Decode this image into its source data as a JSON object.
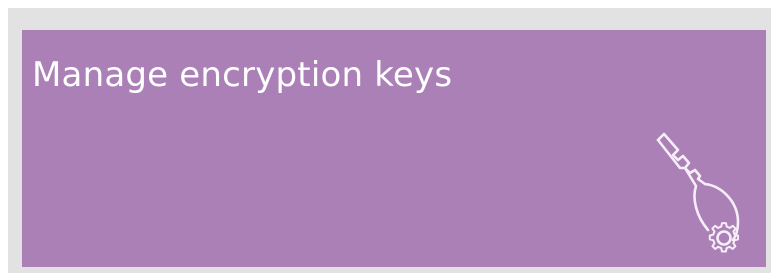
{
  "tile": {
    "title": "Manage encryption keys",
    "icon": "key-gear-icon",
    "background_color": "#ab80b7",
    "text_color": "#ffffff"
  }
}
